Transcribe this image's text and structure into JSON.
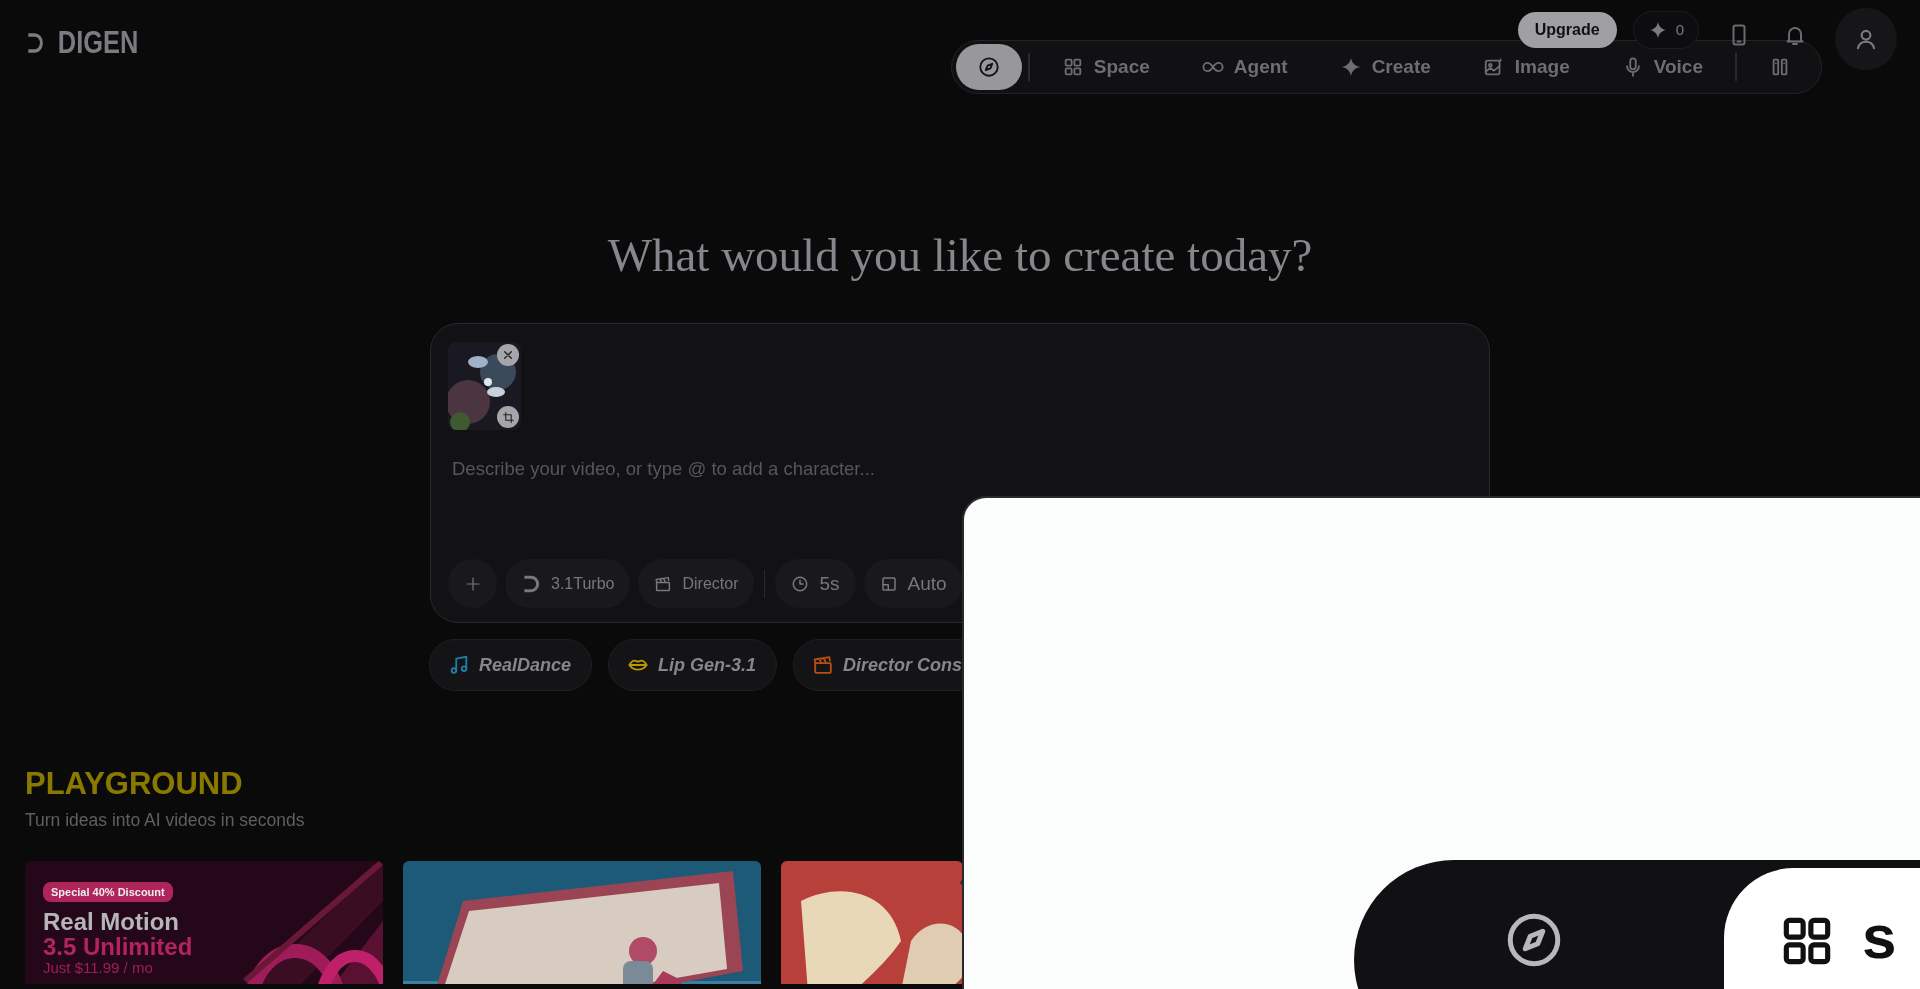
{
  "logo": {
    "text": "DIGEN"
  },
  "nav": {
    "items": [
      {
        "kind": "icon",
        "selected": true
      },
      {
        "kind": "divider"
      },
      {
        "kind": "tab",
        "label": "Space",
        "selected": false
      },
      {
        "kind": "tab",
        "label": "Agent",
        "selected": false
      },
      {
        "kind": "tab",
        "label": "Create",
        "selected": false
      },
      {
        "kind": "tab",
        "label": "Image",
        "selected": false
      },
      {
        "kind": "tab",
        "label": "Voice",
        "selected": false
      },
      {
        "kind": "divider"
      },
      {
        "kind": "icon",
        "selected": false
      }
    ]
  },
  "account": {
    "upgrade_button": "Upgrade",
    "credits": "0"
  },
  "heading": "What would you like to create today?",
  "prompt": {
    "attachment": {
      "kind": "picture"
    },
    "placeholder": "Describe your video, or type @ to add a character...",
    "tools": [
      {
        "kind": "add"
      },
      {
        "kind": "model",
        "label": "3.1Turbo"
      },
      {
        "kind": "mode",
        "label": "Director"
      },
      {
        "kind": "divider"
      },
      {
        "kind": "duration",
        "label": "5s"
      },
      {
        "kind": "ratio",
        "label": "Auto"
      }
    ]
  },
  "chips": [
    {
      "kind": "music",
      "label": "RealDance",
      "color": "#1c7fa3"
    },
    {
      "kind": "lips",
      "label": "Lip Gen-3.1",
      "color": "#b89a00"
    },
    {
      "kind": "clapper",
      "label": "Director Cons",
      "color": "#b84f12"
    }
  ],
  "playground": {
    "title": "PLAYGROUND",
    "subtitle": "Turn ideas into AI videos in seconds",
    "cards": [
      {
        "kind": "promo",
        "badge": "Special 40% Discount",
        "title": "Real Motion",
        "highlight": "3.5 Unlimited",
        "price": "Just $11.99 / mo"
      },
      {
        "kind": "picture"
      },
      {
        "kind": "picture"
      }
    ]
  },
  "overlay": {
    "preview_tab": "s"
  }
}
